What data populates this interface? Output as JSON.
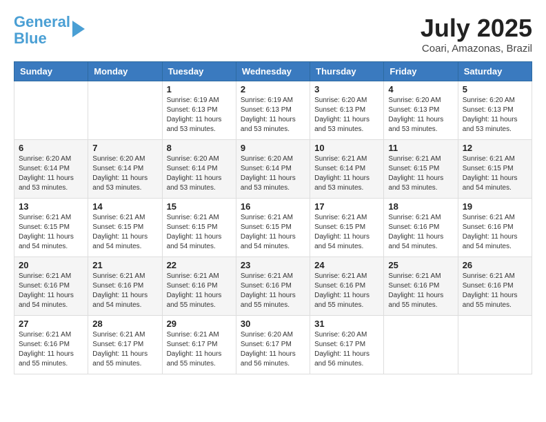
{
  "header": {
    "logo_line1": "General",
    "logo_line2": "Blue",
    "month": "July 2025",
    "location": "Coari, Amazonas, Brazil"
  },
  "weekdays": [
    "Sunday",
    "Monday",
    "Tuesday",
    "Wednesday",
    "Thursday",
    "Friday",
    "Saturday"
  ],
  "weeks": [
    [
      {
        "day": "",
        "info": ""
      },
      {
        "day": "",
        "info": ""
      },
      {
        "day": "1",
        "info": "Sunrise: 6:19 AM\nSunset: 6:13 PM\nDaylight: 11 hours and 53 minutes."
      },
      {
        "day": "2",
        "info": "Sunrise: 6:19 AM\nSunset: 6:13 PM\nDaylight: 11 hours and 53 minutes."
      },
      {
        "day": "3",
        "info": "Sunrise: 6:20 AM\nSunset: 6:13 PM\nDaylight: 11 hours and 53 minutes."
      },
      {
        "day": "4",
        "info": "Sunrise: 6:20 AM\nSunset: 6:13 PM\nDaylight: 11 hours and 53 minutes."
      },
      {
        "day": "5",
        "info": "Sunrise: 6:20 AM\nSunset: 6:13 PM\nDaylight: 11 hours and 53 minutes."
      }
    ],
    [
      {
        "day": "6",
        "info": "Sunrise: 6:20 AM\nSunset: 6:14 PM\nDaylight: 11 hours and 53 minutes."
      },
      {
        "day": "7",
        "info": "Sunrise: 6:20 AM\nSunset: 6:14 PM\nDaylight: 11 hours and 53 minutes."
      },
      {
        "day": "8",
        "info": "Sunrise: 6:20 AM\nSunset: 6:14 PM\nDaylight: 11 hours and 53 minutes."
      },
      {
        "day": "9",
        "info": "Sunrise: 6:20 AM\nSunset: 6:14 PM\nDaylight: 11 hours and 53 minutes."
      },
      {
        "day": "10",
        "info": "Sunrise: 6:21 AM\nSunset: 6:14 PM\nDaylight: 11 hours and 53 minutes."
      },
      {
        "day": "11",
        "info": "Sunrise: 6:21 AM\nSunset: 6:15 PM\nDaylight: 11 hours and 53 minutes."
      },
      {
        "day": "12",
        "info": "Sunrise: 6:21 AM\nSunset: 6:15 PM\nDaylight: 11 hours and 54 minutes."
      }
    ],
    [
      {
        "day": "13",
        "info": "Sunrise: 6:21 AM\nSunset: 6:15 PM\nDaylight: 11 hours and 54 minutes."
      },
      {
        "day": "14",
        "info": "Sunrise: 6:21 AM\nSunset: 6:15 PM\nDaylight: 11 hours and 54 minutes."
      },
      {
        "day": "15",
        "info": "Sunrise: 6:21 AM\nSunset: 6:15 PM\nDaylight: 11 hours and 54 minutes."
      },
      {
        "day": "16",
        "info": "Sunrise: 6:21 AM\nSunset: 6:15 PM\nDaylight: 11 hours and 54 minutes."
      },
      {
        "day": "17",
        "info": "Sunrise: 6:21 AM\nSunset: 6:15 PM\nDaylight: 11 hours and 54 minutes."
      },
      {
        "day": "18",
        "info": "Sunrise: 6:21 AM\nSunset: 6:16 PM\nDaylight: 11 hours and 54 minutes."
      },
      {
        "day": "19",
        "info": "Sunrise: 6:21 AM\nSunset: 6:16 PM\nDaylight: 11 hours and 54 minutes."
      }
    ],
    [
      {
        "day": "20",
        "info": "Sunrise: 6:21 AM\nSunset: 6:16 PM\nDaylight: 11 hours and 54 minutes."
      },
      {
        "day": "21",
        "info": "Sunrise: 6:21 AM\nSunset: 6:16 PM\nDaylight: 11 hours and 54 minutes."
      },
      {
        "day": "22",
        "info": "Sunrise: 6:21 AM\nSunset: 6:16 PM\nDaylight: 11 hours and 55 minutes."
      },
      {
        "day": "23",
        "info": "Sunrise: 6:21 AM\nSunset: 6:16 PM\nDaylight: 11 hours and 55 minutes."
      },
      {
        "day": "24",
        "info": "Sunrise: 6:21 AM\nSunset: 6:16 PM\nDaylight: 11 hours and 55 minutes."
      },
      {
        "day": "25",
        "info": "Sunrise: 6:21 AM\nSunset: 6:16 PM\nDaylight: 11 hours and 55 minutes."
      },
      {
        "day": "26",
        "info": "Sunrise: 6:21 AM\nSunset: 6:16 PM\nDaylight: 11 hours and 55 minutes."
      }
    ],
    [
      {
        "day": "27",
        "info": "Sunrise: 6:21 AM\nSunset: 6:16 PM\nDaylight: 11 hours and 55 minutes."
      },
      {
        "day": "28",
        "info": "Sunrise: 6:21 AM\nSunset: 6:17 PM\nDaylight: 11 hours and 55 minutes."
      },
      {
        "day": "29",
        "info": "Sunrise: 6:21 AM\nSunset: 6:17 PM\nDaylight: 11 hours and 55 minutes."
      },
      {
        "day": "30",
        "info": "Sunrise: 6:20 AM\nSunset: 6:17 PM\nDaylight: 11 hours and 56 minutes."
      },
      {
        "day": "31",
        "info": "Sunrise: 6:20 AM\nSunset: 6:17 PM\nDaylight: 11 hours and 56 minutes."
      },
      {
        "day": "",
        "info": ""
      },
      {
        "day": "",
        "info": ""
      }
    ]
  ]
}
